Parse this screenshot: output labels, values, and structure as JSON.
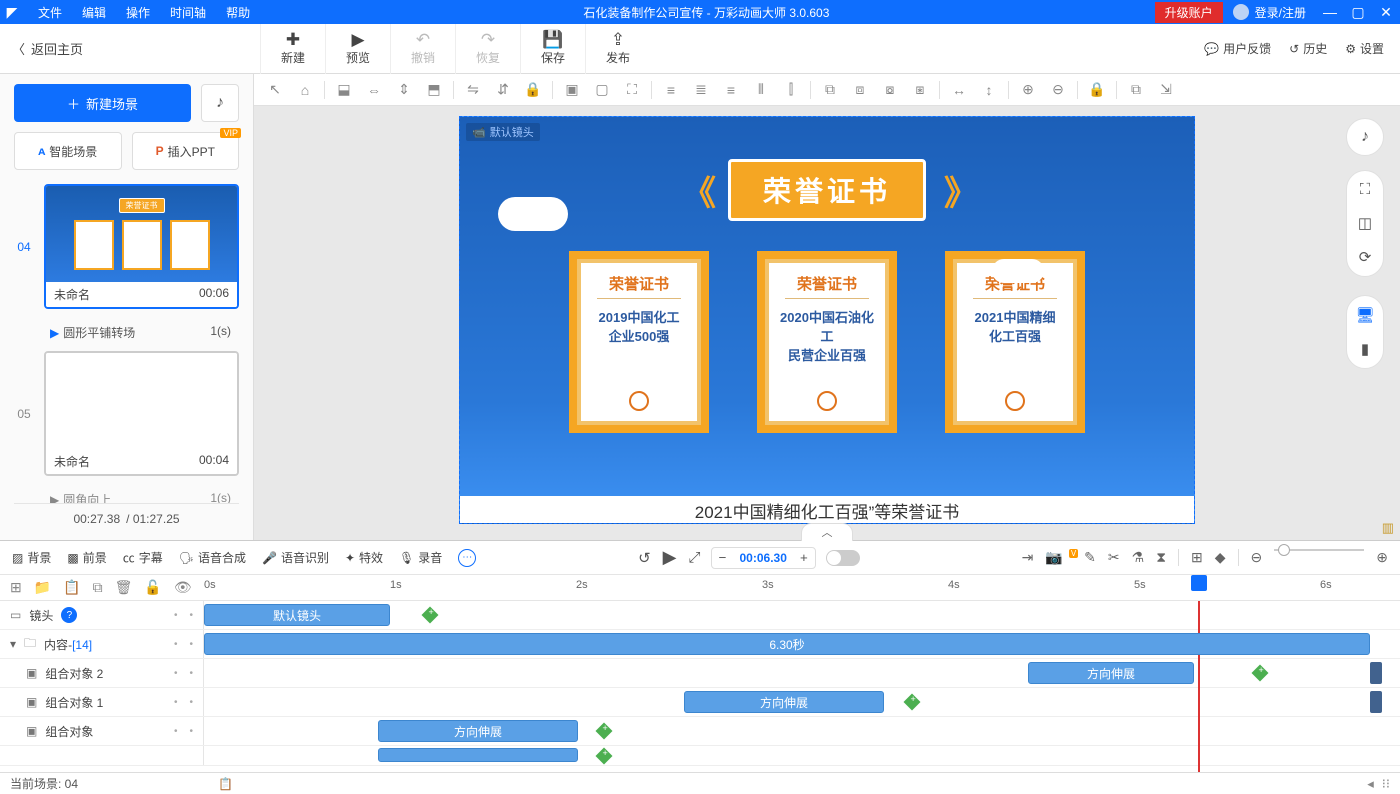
{
  "title_bar": {
    "menus": [
      "文件",
      "编辑",
      "操作",
      "时间轴",
      "帮助"
    ],
    "title": "石化装备制作公司宣传 - 万彩动画大师 3.0.603",
    "upgrade": "升级账户",
    "login": "登录/注册"
  },
  "toolbar": {
    "back": "返回主页",
    "buttons": [
      {
        "label": "新建",
        "glyph": "✚"
      },
      {
        "label": "预览",
        "glyph": "▶"
      },
      {
        "label": "撤销",
        "glyph": "↶",
        "disabled": true
      },
      {
        "label": "恢复",
        "glyph": "↷",
        "disabled": true
      },
      {
        "label": "保存",
        "glyph": "💾"
      },
      {
        "label": "发布",
        "glyph": "⇪"
      }
    ],
    "right": {
      "feedback": "用户反馈",
      "history": "历史",
      "settings": "设置"
    }
  },
  "sidebar": {
    "new_scene": "新建场景",
    "smart_scene": "智能场景",
    "insert_ppt": "插入PPT",
    "scenes": [
      {
        "idx": "04",
        "name": "未命名",
        "dur": "00:06",
        "trans": "圆形平铺转场",
        "trans_dur": "1(s)"
      },
      {
        "idx": "05",
        "name": "未命名",
        "dur": "00:04",
        "trans": "圆角向上",
        "trans_dur": "1(s)"
      }
    ],
    "time_cur": "00:27.38",
    "time_total": "/ 01:27.25"
  },
  "stage": {
    "cam_label": "默认镜头",
    "banner": "荣誉证书",
    "certs": [
      {
        "title": "荣誉证书",
        "body": "2019中国化工\n企业500强"
      },
      {
        "title": "荣誉证书",
        "body": "2020中国石油化工\n民营企业百强"
      },
      {
        "title": "荣誉证书",
        "body": "2021中国精细\n化工百强"
      }
    ],
    "caption": "2021中国精细化工百强”等荣誉证书"
  },
  "timeline_tabs": {
    "items": [
      "背景",
      "前景",
      "字幕",
      "语音合成",
      "语音识别",
      "特效",
      "录音"
    ],
    "time_value": "00:06.30"
  },
  "ruler_ticks": [
    "0s",
    "1s",
    "2s",
    "3s",
    "4s",
    "5s",
    "6s"
  ],
  "tracks": {
    "camera": {
      "label": "镜头",
      "bar": "默认镜头"
    },
    "content": {
      "label": "内容",
      "count": "[14]",
      "bar": "6.30秒"
    },
    "g2": {
      "label": "组合对象 2",
      "bar": "方向伸展"
    },
    "g1": {
      "label": "组合对象 1",
      "bar": "方向伸展"
    },
    "g0": {
      "label": "组合对象",
      "bar": "方向伸展"
    }
  },
  "status": {
    "scene": "当前场景: 04"
  }
}
